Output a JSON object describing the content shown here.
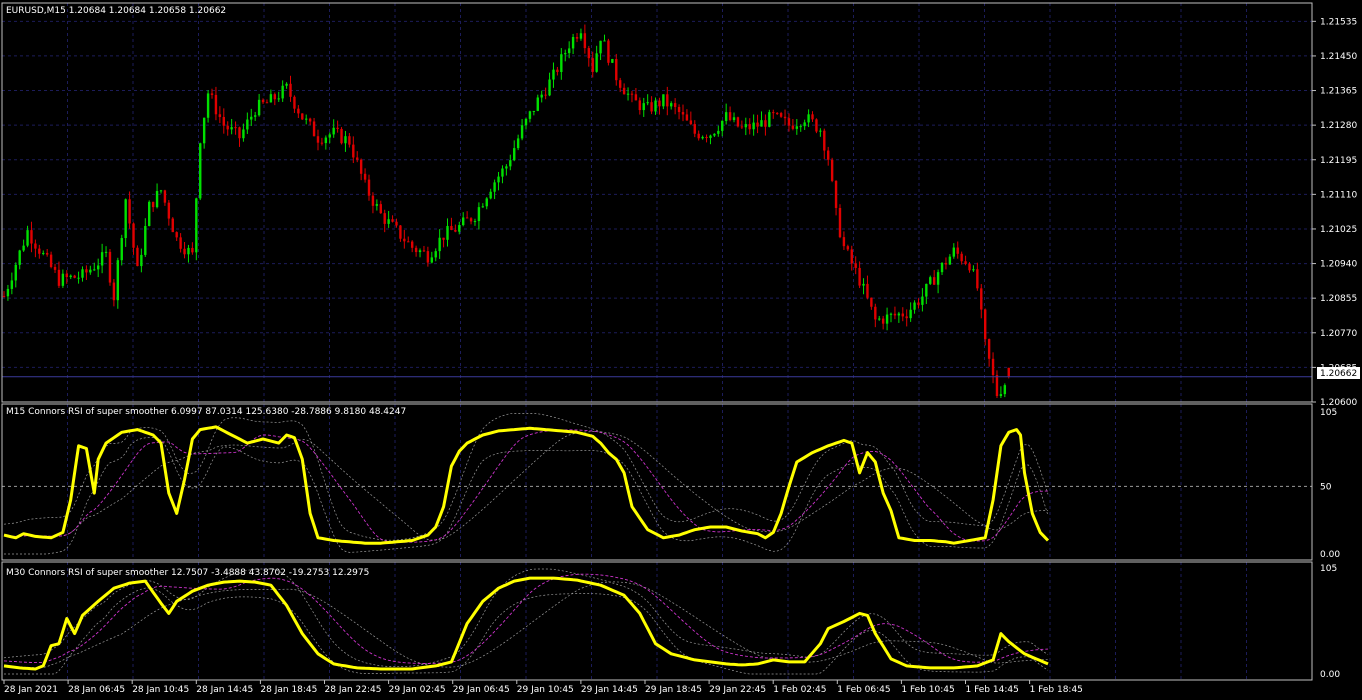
{
  "colors": {
    "background": "#000000",
    "frame": "#c0c0c0",
    "grid": "#1c1c5a",
    "bull": "#00e000",
    "bear": "#e00000",
    "indicator_main": "#ffff00",
    "indicator_signal": "#cc33cc",
    "indicator_bands": "#9a9a9a",
    "price_line": "#3a3a9a",
    "price_tag_bg": "#ffffff",
    "price_tag_fg": "#000000"
  },
  "main_header": "EURUSD,M15  1.20684 1.20684 1.20658 1.20662",
  "current_price": "1.20662",
  "price_labels": [
    "1.21535",
    "1.21450",
    "1.21365",
    "1.21280",
    "1.21195",
    "1.21110",
    "1.21025",
    "1.20940",
    "1.20855",
    "1.20770",
    "1.20685",
    "1.20600"
  ],
  "indicator1": {
    "header": "M15 Connors RSI of super smoother 6.0997 87.0314 125.6380 -28.7886 9.8180 48.4247",
    "labels": [
      "105",
      "50",
      "0.00"
    ]
  },
  "indicator2": {
    "header": "M30 Connors RSI of super smoother 12.7507 -3.4888 43.8702 -19.2753 12.2975",
    "labels": [
      "105",
      "0.00"
    ]
  },
  "time_labels": [
    "28 Jan 2021",
    "28 Jan 06:45",
    "28 Jan 10:45",
    "28 Jan 14:45",
    "28 Jan 18:45",
    "28 Jan 22:45",
    "29 Jan 02:45",
    "29 Jan 06:45",
    "29 Jan 10:45",
    "29 Jan 14:45",
    "29 Jan 18:45",
    "29 Jan 22:45",
    "1 Feb 02:45",
    "1 Feb 06:45",
    "1 Feb 10:45",
    "1 Feb 14:45",
    "1 Feb 18:45"
  ],
  "chart_data": {
    "type": "candlestick",
    "symbol": "EURUSD",
    "timeframe": "M15",
    "ylim": [
      1.206,
      1.2158
    ],
    "last": {
      "open": 1.20684,
      "high": 1.20684,
      "low": 1.20658,
      "close": 1.20662
    },
    "close_path": [
      [
        0,
        1.2086
      ],
      [
        6,
        1.2102
      ],
      [
        10,
        1.2096
      ],
      [
        14,
        1.209
      ],
      [
        20,
        1.2091
      ],
      [
        26,
        1.2096
      ],
      [
        28,
        1.2086
      ],
      [
        31,
        1.211
      ],
      [
        34,
        1.2092
      ],
      [
        37,
        1.2108
      ],
      [
        40,
        1.2112
      ],
      [
        44,
        1.21
      ],
      [
        48,
        1.2096
      ],
      [
        50,
        1.2125
      ],
      [
        52,
        1.2136
      ],
      [
        56,
        1.2128
      ],
      [
        60,
        1.2125
      ],
      [
        64,
        1.2132
      ],
      [
        68,
        1.2134
      ],
      [
        72,
        1.2137
      ],
      [
        76,
        1.213
      ],
      [
        80,
        1.2125
      ],
      [
        84,
        1.2126
      ],
      [
        88,
        1.2124
      ],
      [
        92,
        1.2113
      ],
      [
        96,
        1.2106
      ],
      [
        100,
        1.2102
      ],
      [
        104,
        1.2098
      ],
      [
        108,
        1.2096
      ],
      [
        112,
        1.2101
      ],
      [
        116,
        1.2103
      ],
      [
        120,
        1.2106
      ],
      [
        124,
        1.2113
      ],
      [
        128,
        1.2118
      ],
      [
        132,
        1.2127
      ],
      [
        136,
        1.2134
      ],
      [
        140,
        1.214
      ],
      [
        144,
        1.2148
      ],
      [
        147,
        1.2152
      ],
      [
        150,
        1.2142
      ],
      [
        152,
        1.215
      ],
      [
        156,
        1.214
      ],
      [
        160,
        1.2134
      ],
      [
        164,
        1.2132
      ],
      [
        168,
        1.2134
      ],
      [
        172,
        1.2131
      ],
      [
        176,
        1.2126
      ],
      [
        180,
        1.2126
      ],
      [
        184,
        1.213
      ],
      [
        188,
        1.2127
      ],
      [
        192,
        1.2128
      ],
      [
        196,
        1.213
      ],
      [
        200,
        1.2128
      ],
      [
        204,
        1.213
      ],
      [
        208,
        1.2127
      ],
      [
        210,
        1.212
      ],
      [
        212,
        1.2106
      ],
      [
        214,
        1.2098
      ],
      [
        218,
        1.209
      ],
      [
        222,
        1.208
      ],
      [
        226,
        1.2081
      ],
      [
        230,
        1.2082
      ],
      [
        234,
        1.2086
      ],
      [
        238,
        1.2092
      ],
      [
        242,
        1.2097
      ],
      [
        246,
        1.2094
      ],
      [
        248,
        1.2088
      ],
      [
        250,
        1.2074
      ],
      [
        253,
        1.2062
      ],
      [
        256,
        1.2066
      ]
    ],
    "indicator1_main": [
      [
        0,
        14
      ],
      [
        3,
        12
      ],
      [
        5,
        15
      ],
      [
        8,
        13
      ],
      [
        12,
        12
      ],
      [
        15,
        16
      ],
      [
        17,
        40
      ],
      [
        19,
        80
      ],
      [
        21,
        78
      ],
      [
        23,
        45
      ],
      [
        24,
        70
      ],
      [
        26,
        82
      ],
      [
        30,
        90
      ],
      [
        34,
        92
      ],
      [
        38,
        88
      ],
      [
        40,
        82
      ],
      [
        42,
        45
      ],
      [
        44,
        30
      ],
      [
        46,
        55
      ],
      [
        48,
        85
      ],
      [
        50,
        92
      ],
      [
        54,
        94
      ],
      [
        58,
        88
      ],
      [
        62,
        82
      ],
      [
        66,
        85
      ],
      [
        70,
        82
      ],
      [
        72,
        88
      ],
      [
        74,
        86
      ],
      [
        76,
        70
      ],
      [
        78,
        30
      ],
      [
        80,
        12
      ],
      [
        84,
        10
      ],
      [
        88,
        9
      ],
      [
        92,
        8
      ],
      [
        96,
        8
      ],
      [
        100,
        9
      ],
      [
        104,
        10
      ],
      [
        108,
        14
      ],
      [
        110,
        20
      ],
      [
        112,
        35
      ],
      [
        114,
        65
      ],
      [
        116,
        76
      ],
      [
        118,
        82
      ],
      [
        122,
        88
      ],
      [
        126,
        91
      ],
      [
        130,
        92
      ],
      [
        134,
        93
      ],
      [
        138,
        92
      ],
      [
        142,
        91
      ],
      [
        146,
        90
      ],
      [
        150,
        87
      ],
      [
        152,
        82
      ],
      [
        154,
        75
      ],
      [
        156,
        70
      ],
      [
        158,
        60
      ],
      [
        160,
        35
      ],
      [
        164,
        18
      ],
      [
        168,
        12
      ],
      [
        172,
        14
      ],
      [
        176,
        18
      ],
      [
        180,
        20
      ],
      [
        184,
        20
      ],
      [
        188,
        17
      ],
      [
        192,
        15
      ],
      [
        194,
        12
      ],
      [
        196,
        16
      ],
      [
        198,
        30
      ],
      [
        200,
        50
      ],
      [
        202,
        68
      ],
      [
        206,
        75
      ],
      [
        210,
        80
      ],
      [
        214,
        84
      ],
      [
        216,
        82
      ],
      [
        218,
        60
      ],
      [
        220,
        75
      ],
      [
        222,
        68
      ],
      [
        224,
        45
      ],
      [
        226,
        32
      ],
      [
        228,
        12
      ],
      [
        232,
        10
      ],
      [
        236,
        10
      ],
      [
        240,
        9
      ],
      [
        242,
        8
      ],
      [
        246,
        10
      ],
      [
        250,
        12
      ],
      [
        252,
        40
      ],
      [
        254,
        80
      ],
      [
        256,
        90
      ],
      [
        258,
        92
      ],
      [
        259,
        88
      ],
      [
        260,
        60
      ],
      [
        262,
        30
      ],
      [
        264,
        16
      ],
      [
        266,
        10
      ]
    ],
    "indicator2_main": [
      [
        0,
        8
      ],
      [
        4,
        6
      ],
      [
        8,
        5
      ],
      [
        10,
        8
      ],
      [
        12,
        28
      ],
      [
        14,
        30
      ],
      [
        16,
        55
      ],
      [
        18,
        40
      ],
      [
        20,
        58
      ],
      [
        24,
        72
      ],
      [
        28,
        85
      ],
      [
        32,
        90
      ],
      [
        36,
        92
      ],
      [
        40,
        70
      ],
      [
        42,
        60
      ],
      [
        44,
        72
      ],
      [
        48,
        82
      ],
      [
        52,
        88
      ],
      [
        56,
        91
      ],
      [
        60,
        92
      ],
      [
        64,
        91
      ],
      [
        68,
        88
      ],
      [
        72,
        68
      ],
      [
        76,
        40
      ],
      [
        80,
        20
      ],
      [
        84,
        10
      ],
      [
        90,
        6
      ],
      [
        96,
        5
      ],
      [
        104,
        5
      ],
      [
        110,
        8
      ],
      [
        114,
        12
      ],
      [
        118,
        50
      ],
      [
        122,
        72
      ],
      [
        126,
        85
      ],
      [
        130,
        92
      ],
      [
        134,
        95
      ],
      [
        140,
        95
      ],
      [
        146,
        93
      ],
      [
        152,
        88
      ],
      [
        158,
        78
      ],
      [
        162,
        60
      ],
      [
        166,
        30
      ],
      [
        170,
        20
      ],
      [
        176,
        14
      ],
      [
        180,
        12
      ],
      [
        184,
        10
      ],
      [
        188,
        9
      ],
      [
        192,
        10
      ],
      [
        196,
        14
      ],
      [
        200,
        12
      ],
      [
        204,
        12
      ],
      [
        208,
        30
      ],
      [
        210,
        45
      ],
      [
        214,
        52
      ],
      [
        218,
        60
      ],
      [
        220,
        58
      ],
      [
        222,
        40
      ],
      [
        226,
        15
      ],
      [
        230,
        8
      ],
      [
        236,
        6
      ],
      [
        242,
        6
      ],
      [
        248,
        8
      ],
      [
        252,
        14
      ],
      [
        254,
        40
      ],
      [
        256,
        32
      ],
      [
        260,
        20
      ],
      [
        266,
        10
      ]
    ]
  }
}
